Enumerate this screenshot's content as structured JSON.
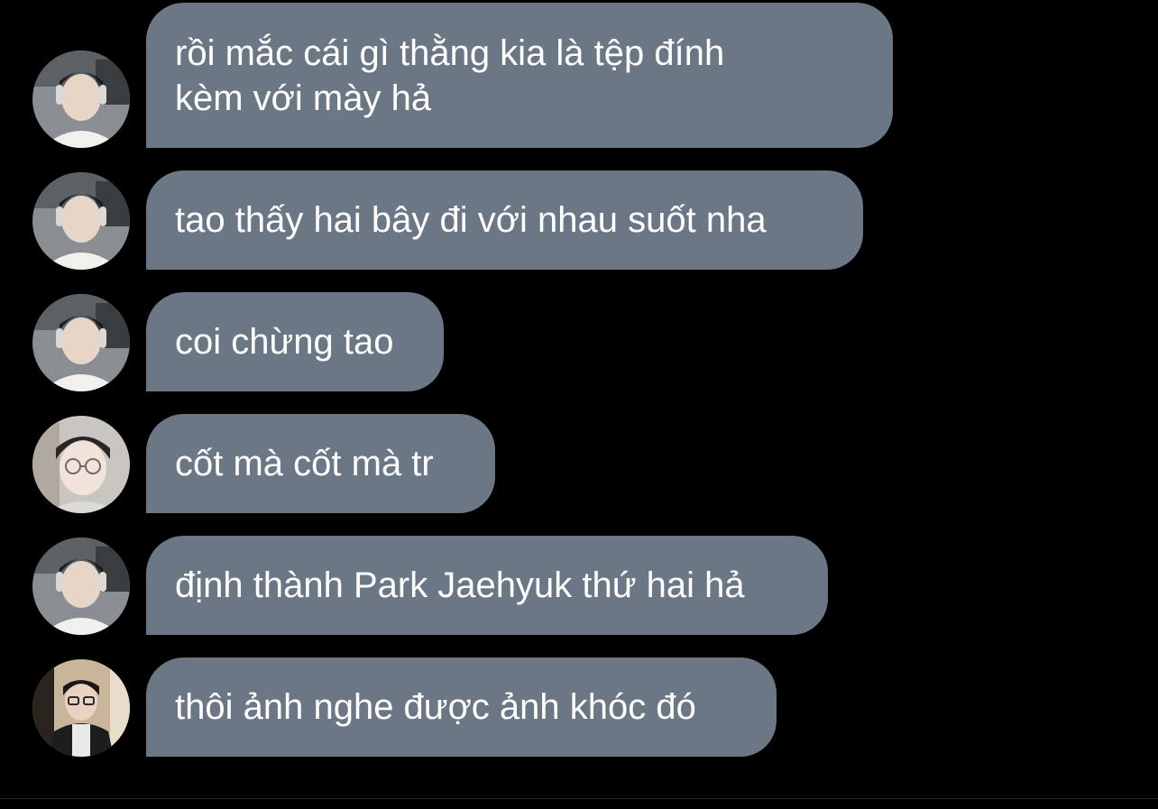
{
  "messages": [
    {
      "text": "rồi mắc cái gì thằng kia là tệp đính\nkèm với mày hả",
      "sender_avatar": "avatar-a"
    },
    {
      "text": "tao thấy hai bây đi với nhau suốt nha",
      "sender_avatar": "avatar-a"
    },
    {
      "text": "coi chừng tao",
      "sender_avatar": "avatar-a"
    },
    {
      "text": "cốt mà cốt mà tr",
      "sender_avatar": "avatar-b"
    },
    {
      "text": "định thành Park Jaehyuk thứ hai hả",
      "sender_avatar": "avatar-a"
    },
    {
      "text": "thôi ảnh nghe được ảnh khóc đó",
      "sender_avatar": "avatar-c"
    }
  ],
  "colors": {
    "background": "#000000",
    "bubble": "#6b7785",
    "text": "#ffffff"
  }
}
